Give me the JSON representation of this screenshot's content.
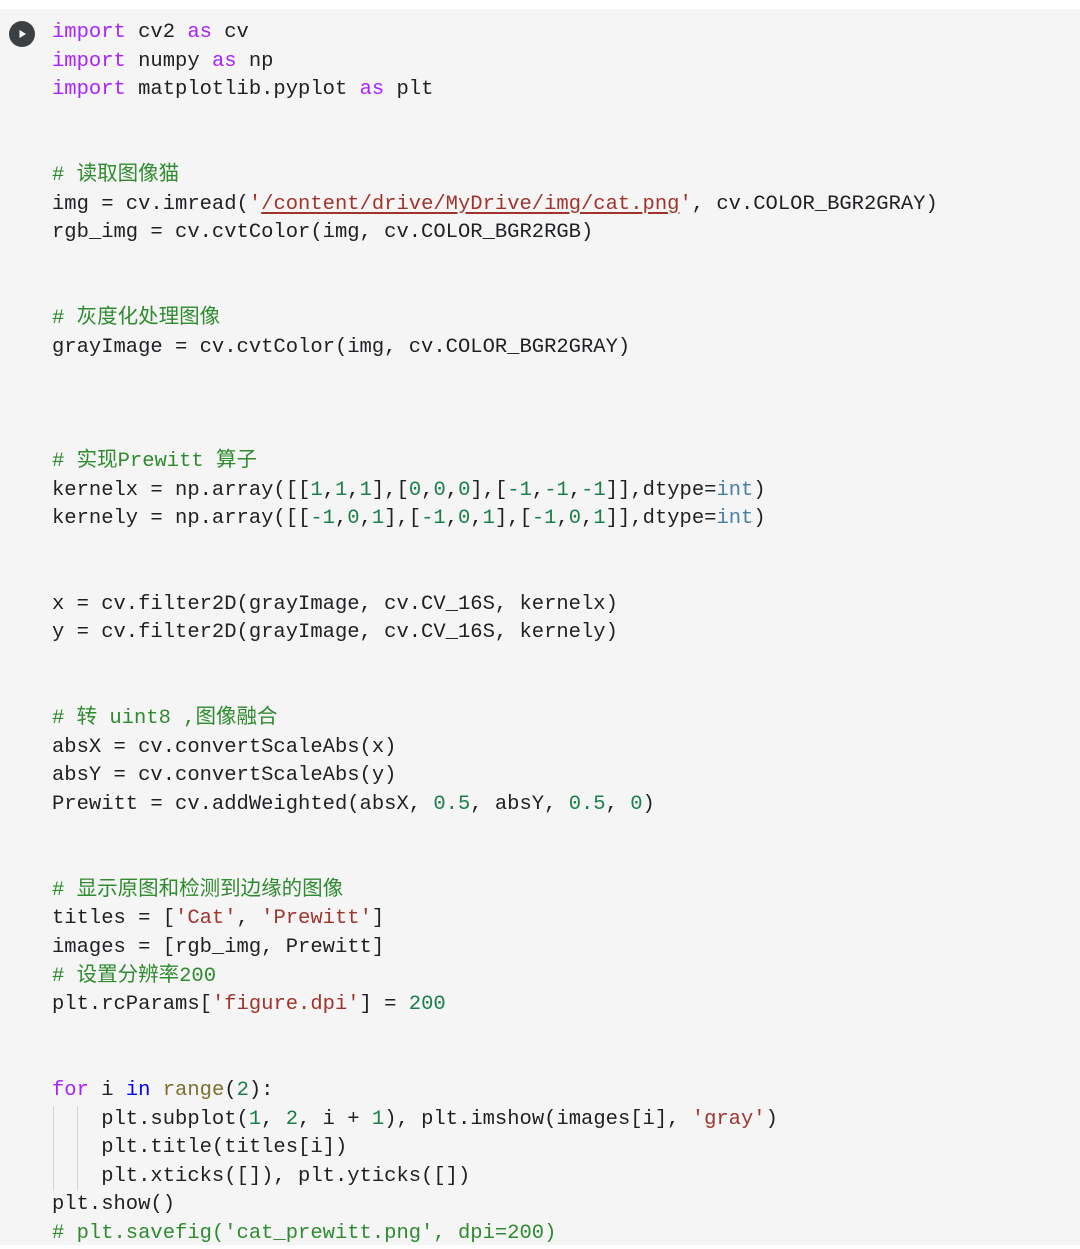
{
  "cell": {
    "kind": "colab-code-cell",
    "language": "python",
    "background_color": "#f5f5f6",
    "run_button": {
      "name": "run-cell-button",
      "icon": "play-icon",
      "tooltip": "Run cell"
    }
  },
  "colors": {
    "keyword": "#aa22ff",
    "keyword_operator": "#0000ff",
    "builtin_type": "#4a7fa5",
    "function": "#7d6f2e",
    "number": "#1a7f4b",
    "string": "#a0342c",
    "comment": "#2e8b2e",
    "text": "#202124",
    "indent_guide": "#d4d4d4",
    "run_button_bg": "#3c4043"
  },
  "code": {
    "lines": [
      {
        "n": 1,
        "indent": 0,
        "tokens": [
          {
            "t": "import",
            "c": "kw"
          },
          {
            "t": " cv2 ",
            "c": "op"
          },
          {
            "t": "as",
            "c": "kw"
          },
          {
            "t": " cv",
            "c": "op"
          }
        ]
      },
      {
        "n": 2,
        "indent": 0,
        "tokens": [
          {
            "t": "import",
            "c": "kw"
          },
          {
            "t": " numpy ",
            "c": "op"
          },
          {
            "t": "as",
            "c": "kw"
          },
          {
            "t": " np",
            "c": "op"
          }
        ]
      },
      {
        "n": 3,
        "indent": 0,
        "tokens": [
          {
            "t": "import",
            "c": "kw"
          },
          {
            "t": " matplotlib.pyplot ",
            "c": "op"
          },
          {
            "t": "as",
            "c": "kw"
          },
          {
            "t": " plt",
            "c": "op"
          }
        ]
      },
      {
        "n": 4,
        "indent": 0,
        "tokens": []
      },
      {
        "n": 5,
        "indent": 0,
        "tokens": []
      },
      {
        "n": 6,
        "indent": 0,
        "tokens": [
          {
            "t": "# 读取图像猫",
            "c": "cmt"
          }
        ]
      },
      {
        "n": 7,
        "indent": 0,
        "tokens": [
          {
            "t": "img = cv.imread(",
            "c": "op"
          },
          {
            "t": "'",
            "c": "str"
          },
          {
            "t": "/content/drive/MyDrive/img/cat.png",
            "c": "str-u"
          },
          {
            "t": "'",
            "c": "str"
          },
          {
            "t": ", cv.COLOR_BGR2GRAY)",
            "c": "op"
          }
        ]
      },
      {
        "n": 8,
        "indent": 0,
        "tokens": [
          {
            "t": "rgb_img = cv.cvtColor(img, cv.COLOR_BGR2RGB)",
            "c": "op"
          }
        ]
      },
      {
        "n": 9,
        "indent": 0,
        "tokens": []
      },
      {
        "n": 10,
        "indent": 0,
        "tokens": []
      },
      {
        "n": 11,
        "indent": 0,
        "tokens": [
          {
            "t": "# 灰度化处理图像",
            "c": "cmt"
          }
        ]
      },
      {
        "n": 12,
        "indent": 0,
        "tokens": [
          {
            "t": "grayImage = cv.cvtColor(img, cv.COLOR_BGR2GRAY)",
            "c": "op"
          }
        ]
      },
      {
        "n": 13,
        "indent": 0,
        "tokens": []
      },
      {
        "n": 14,
        "indent": 0,
        "tokens": []
      },
      {
        "n": 15,
        "indent": 0,
        "tokens": []
      },
      {
        "n": 16,
        "indent": 0,
        "tokens": [
          {
            "t": "# 实现Prewitt 算子",
            "c": "cmt"
          }
        ]
      },
      {
        "n": 17,
        "indent": 0,
        "tokens": [
          {
            "t": "kernelx = np.array([[",
            "c": "op"
          },
          {
            "t": "1",
            "c": "num"
          },
          {
            "t": ",",
            "c": "op"
          },
          {
            "t": "1",
            "c": "num"
          },
          {
            "t": ",",
            "c": "op"
          },
          {
            "t": "1",
            "c": "num"
          },
          {
            "t": "],[",
            "c": "op"
          },
          {
            "t": "0",
            "c": "num"
          },
          {
            "t": ",",
            "c": "op"
          },
          {
            "t": "0",
            "c": "num"
          },
          {
            "t": ",",
            "c": "op"
          },
          {
            "t": "0",
            "c": "num"
          },
          {
            "t": "],[",
            "c": "op"
          },
          {
            "t": "-1",
            "c": "num"
          },
          {
            "t": ",",
            "c": "op"
          },
          {
            "t": "-1",
            "c": "num"
          },
          {
            "t": ",",
            "c": "op"
          },
          {
            "t": "-1",
            "c": "num"
          },
          {
            "t": "]],dtype=",
            "c": "op"
          },
          {
            "t": "int",
            "c": "bi"
          },
          {
            "t": ")",
            "c": "op"
          }
        ]
      },
      {
        "n": 18,
        "indent": 0,
        "tokens": [
          {
            "t": "kernely = np.array([[",
            "c": "op"
          },
          {
            "t": "-1",
            "c": "num"
          },
          {
            "t": ",",
            "c": "op"
          },
          {
            "t": "0",
            "c": "num"
          },
          {
            "t": ",",
            "c": "op"
          },
          {
            "t": "1",
            "c": "num"
          },
          {
            "t": "],[",
            "c": "op"
          },
          {
            "t": "-1",
            "c": "num"
          },
          {
            "t": ",",
            "c": "op"
          },
          {
            "t": "0",
            "c": "num"
          },
          {
            "t": ",",
            "c": "op"
          },
          {
            "t": "1",
            "c": "num"
          },
          {
            "t": "],[",
            "c": "op"
          },
          {
            "t": "-1",
            "c": "num"
          },
          {
            "t": ",",
            "c": "op"
          },
          {
            "t": "0",
            "c": "num"
          },
          {
            "t": ",",
            "c": "op"
          },
          {
            "t": "1",
            "c": "num"
          },
          {
            "t": "]],dtype=",
            "c": "op"
          },
          {
            "t": "int",
            "c": "bi"
          },
          {
            "t": ")",
            "c": "op"
          }
        ]
      },
      {
        "n": 19,
        "indent": 0,
        "tokens": []
      },
      {
        "n": 20,
        "indent": 0,
        "tokens": []
      },
      {
        "n": 21,
        "indent": 0,
        "tokens": [
          {
            "t": "x = cv.filter2D(grayImage, cv.CV_16S, kernelx)",
            "c": "op"
          }
        ]
      },
      {
        "n": 22,
        "indent": 0,
        "tokens": [
          {
            "t": "y = cv.filter2D(grayImage, cv.CV_16S, kernely)",
            "c": "op"
          }
        ]
      },
      {
        "n": 23,
        "indent": 0,
        "tokens": []
      },
      {
        "n": 24,
        "indent": 0,
        "tokens": []
      },
      {
        "n": 25,
        "indent": 0,
        "tokens": [
          {
            "t": "# 转 uint8 ,图像融合",
            "c": "cmt"
          }
        ]
      },
      {
        "n": 26,
        "indent": 0,
        "tokens": [
          {
            "t": "absX = cv.convertScaleAbs(x)",
            "c": "op"
          }
        ]
      },
      {
        "n": 27,
        "indent": 0,
        "tokens": [
          {
            "t": "absY = cv.convertScaleAbs(y)",
            "c": "op"
          }
        ]
      },
      {
        "n": 28,
        "indent": 0,
        "tokens": [
          {
            "t": "Prewitt = cv.addWeighted(absX, ",
            "c": "op"
          },
          {
            "t": "0.5",
            "c": "num"
          },
          {
            "t": ", absY, ",
            "c": "op"
          },
          {
            "t": "0.5",
            "c": "num"
          },
          {
            "t": ", ",
            "c": "op"
          },
          {
            "t": "0",
            "c": "num"
          },
          {
            "t": ")",
            "c": "op"
          }
        ]
      },
      {
        "n": 29,
        "indent": 0,
        "tokens": []
      },
      {
        "n": 30,
        "indent": 0,
        "tokens": []
      },
      {
        "n": 31,
        "indent": 0,
        "tokens": [
          {
            "t": "# 显示原图和检测到边缘的图像",
            "c": "cmt"
          }
        ]
      },
      {
        "n": 32,
        "indent": 0,
        "tokens": [
          {
            "t": "titles = [",
            "c": "op"
          },
          {
            "t": "'Cat'",
            "c": "str"
          },
          {
            "t": ", ",
            "c": "op"
          },
          {
            "t": "'Prewitt'",
            "c": "str"
          },
          {
            "t": "]",
            "c": "op"
          }
        ]
      },
      {
        "n": 33,
        "indent": 0,
        "tokens": [
          {
            "t": "images = [rgb_img, Prewitt]",
            "c": "op"
          }
        ]
      },
      {
        "n": 34,
        "indent": 0,
        "tokens": [
          {
            "t": "# 设置分辨率200",
            "c": "cmt"
          }
        ]
      },
      {
        "n": 35,
        "indent": 0,
        "tokens": [
          {
            "t": "plt.rcParams[",
            "c": "op"
          },
          {
            "t": "'figure.dpi'",
            "c": "str"
          },
          {
            "t": "] = ",
            "c": "op"
          },
          {
            "t": "200",
            "c": "num"
          }
        ]
      },
      {
        "n": 36,
        "indent": 0,
        "tokens": []
      },
      {
        "n": 37,
        "indent": 0,
        "tokens": []
      },
      {
        "n": 38,
        "indent": 0,
        "tokens": [
          {
            "t": "for",
            "c": "kw"
          },
          {
            "t": " i ",
            "c": "op"
          },
          {
            "t": "in",
            "c": "kw2"
          },
          {
            "t": " ",
            "c": "op"
          },
          {
            "t": "range",
            "c": "fn"
          },
          {
            "t": "(",
            "c": "op"
          },
          {
            "t": "2",
            "c": "num"
          },
          {
            "t": "):",
            "c": "op"
          }
        ]
      },
      {
        "n": 39,
        "indent": 2,
        "tokens": [
          {
            "t": "    plt.subplot(",
            "c": "op"
          },
          {
            "t": "1",
            "c": "num"
          },
          {
            "t": ", ",
            "c": "op"
          },
          {
            "t": "2",
            "c": "num"
          },
          {
            "t": ", i + ",
            "c": "op"
          },
          {
            "t": "1",
            "c": "num"
          },
          {
            "t": "), plt.imshow(images[i], ",
            "c": "op"
          },
          {
            "t": "'gray'",
            "c": "str"
          },
          {
            "t": ")",
            "c": "op"
          }
        ]
      },
      {
        "n": 40,
        "indent": 2,
        "tokens": [
          {
            "t": "    plt.title(titles[i])",
            "c": "op"
          }
        ]
      },
      {
        "n": 41,
        "indent": 2,
        "tokens": [
          {
            "t": "    plt.xticks([]), plt.yticks([])",
            "c": "op"
          }
        ]
      },
      {
        "n": 42,
        "indent": 0,
        "tokens": [
          {
            "t": "plt.show()",
            "c": "op"
          }
        ]
      },
      {
        "n": 43,
        "indent": 0,
        "tokens": [
          {
            "t": "# plt.savefig('cat_prewitt.png', dpi=200)",
            "c": "cmt"
          }
        ]
      }
    ]
  }
}
